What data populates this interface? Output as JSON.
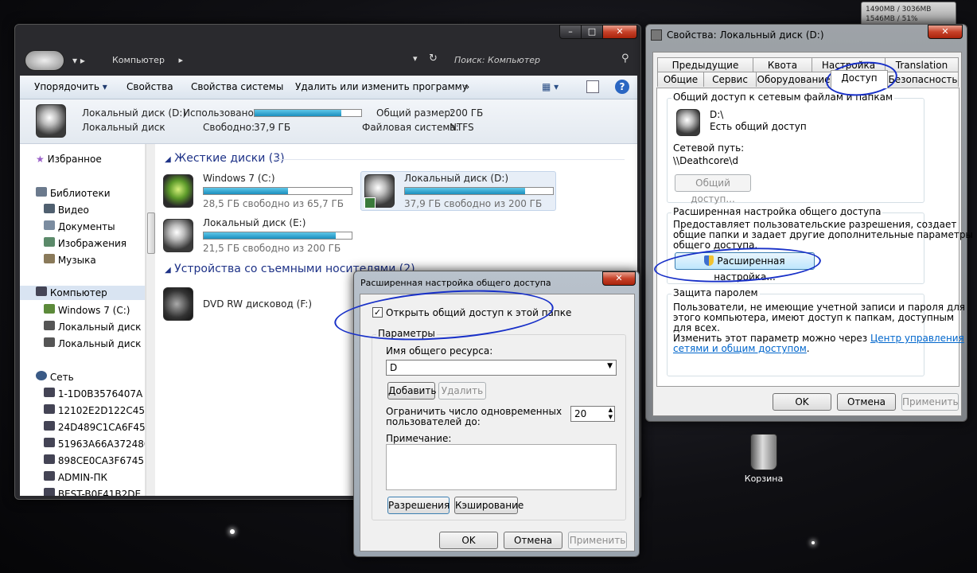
{
  "gadget": {
    "line1": "1490MB / 3036MB",
    "line2": "1546MB / 51%"
  },
  "desktop": {
    "recycle_bin": "Корзина"
  },
  "explorer": {
    "breadcrumb": "Компьютер",
    "search_placeholder": "Поиск: Компьютер",
    "toolbar": {
      "organize": "Упорядочить",
      "properties": "Свойства",
      "system_properties": "Свойства системы",
      "uninstall": "Удалить или изменить программу",
      "more": "»"
    },
    "info": {
      "name": "Локальный диск (D:)",
      "type": "Локальный диск",
      "used_label": "Использовано:",
      "used_fraction": 0.81,
      "free_label": "Свободно:",
      "free_value": "37,9 ГБ",
      "total_label": "Общий размер:",
      "total_value": "200 ГБ",
      "fs_label": "Файловая система:",
      "fs_value": "NTFS"
    },
    "sidebar": {
      "favorites": "Избранное",
      "libraries": "Библиотеки",
      "video": "Видео",
      "documents": "Документы",
      "images": "Изображения",
      "music": "Музыка",
      "computer": "Компьютер",
      "drive_c": "Windows 7 (C:)",
      "drive_d": "Локальный диск",
      "drive_e": "Локальный диск",
      "network": "Сеть",
      "hosts": [
        "1-1D0B3576407A",
        "12102E2D122C45",
        "24D489C1CA6F45",
        "51963A66A372480",
        "898CE0CA3F6745",
        "ADMIN-ПК",
        "BEST-B0F41B2DE"
      ]
    },
    "groups": {
      "hdd": "Жесткие диски (3)",
      "removable": "Устройства со съемными носителями (2)"
    },
    "drives": [
      {
        "name": "Windows 7 (C:)",
        "free": "28,5 ГБ свободно из 65,7 ГБ",
        "used_fraction": 0.57
      },
      {
        "name": "Локальный диск (D:)",
        "free": "37,9 ГБ свободно из 200 ГБ",
        "used_fraction": 0.81
      },
      {
        "name": "Локальный диск (E:)",
        "free": "21,5 ГБ свободно из 200 ГБ",
        "used_fraction": 0.89
      }
    ],
    "dvd": "DVD RW дисковод (F:)"
  },
  "props": {
    "title": "Свойства: Локальный диск (D:)",
    "tabs_top": [
      "Предыдущие версии",
      "Квота",
      "Настройка",
      "Translation"
    ],
    "tabs_bottom": [
      "Общие",
      "Сервис",
      "Оборудование",
      "Доступ",
      "Безопасность"
    ],
    "share_section": "Общий доступ к сетевым файлам и папкам",
    "share_path": "D:\\",
    "share_status": "Есть общий доступ",
    "net_path_label": "Сетевой путь:",
    "net_path": "\\\\Deathcore\\d",
    "share_button": "Общий доступ...",
    "adv_section": "Расширенная настройка общего доступа",
    "adv_desc": [
      "Предоставляет пользовательские разрешения, создает",
      "общие папки и задает другие дополнительные параметры",
      "общего доступа."
    ],
    "adv_button": "Расширенная настройка...",
    "pwd_section": "Защита паролем",
    "pwd_desc": [
      "Пользователи, не имеющие учетной записи и пароля для",
      "этого компьютера, имеют доступ к папкам, доступным",
      "для всех."
    ],
    "pwd_change": "Изменить этот параметр можно через",
    "pwd_link1": "Центр управления",
    "pwd_link2": "сетями и общим доступом",
    "pwd_dot": ".",
    "ok": "OK",
    "cancel": "Отмена",
    "apply": "Применить"
  },
  "adv": {
    "title": "Расширенная настройка общего доступа",
    "share_checkbox": "Открыть общий доступ к этой папке",
    "share_checked": true,
    "params": "Параметры",
    "share_name_label": "Имя общего ресурса:",
    "share_name": "D",
    "add": "Добавить",
    "remove": "Удалить",
    "limit_label_1": "Ограничить число одновременных",
    "limit_label_2": "пользователей до:",
    "limit_value": "20",
    "comment_label": "Примечание:",
    "permissions": "Разрешения",
    "caching": "Кэширование",
    "ok": "OK",
    "cancel": "Отмена",
    "apply": "Применить"
  }
}
